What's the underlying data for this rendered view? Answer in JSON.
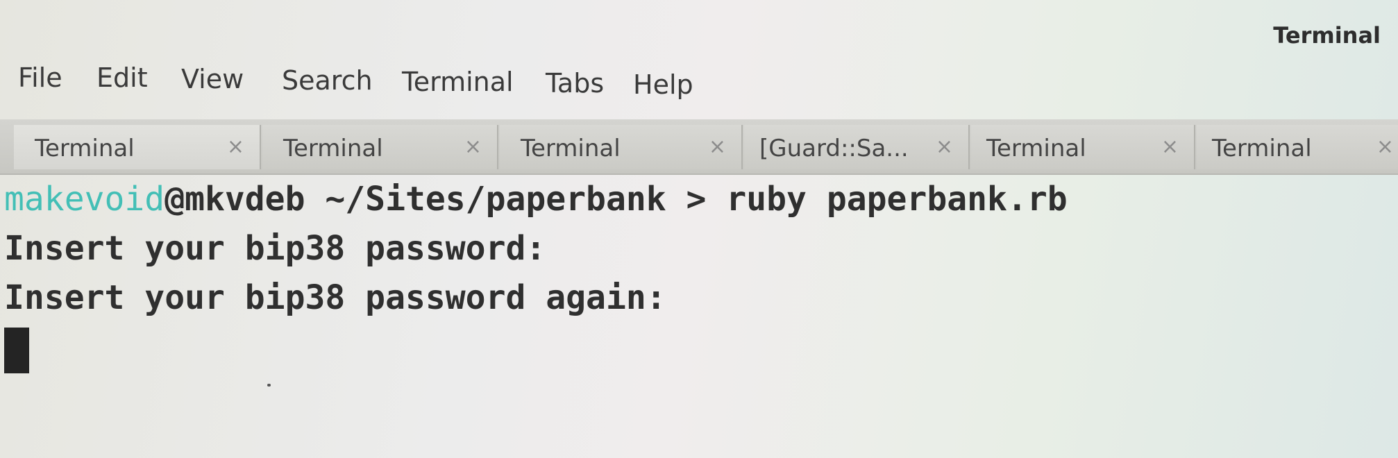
{
  "window": {
    "title": "Terminal"
  },
  "menu": {
    "items": [
      "File",
      "Edit",
      "View",
      "Search",
      "Terminal",
      "Tabs",
      "Help"
    ]
  },
  "tabs": [
    {
      "label": "Terminal",
      "close": "×"
    },
    {
      "label": "Terminal",
      "close": "×"
    },
    {
      "label": "Terminal",
      "close": "×"
    },
    {
      "label": "[Guard::Sa...",
      "close": "×"
    },
    {
      "label": "Terminal",
      "close": "×"
    },
    {
      "label": "Terminal",
      "close": "×"
    }
  ],
  "terminal": {
    "prompt_user": "makevoid",
    "prompt_rest": "@mkvdeb ~/Sites/paperbank > ruby paperbank.rb",
    "lines": [
      "Insert your bip38 password:",
      "Insert your bip38 password again:"
    ]
  }
}
